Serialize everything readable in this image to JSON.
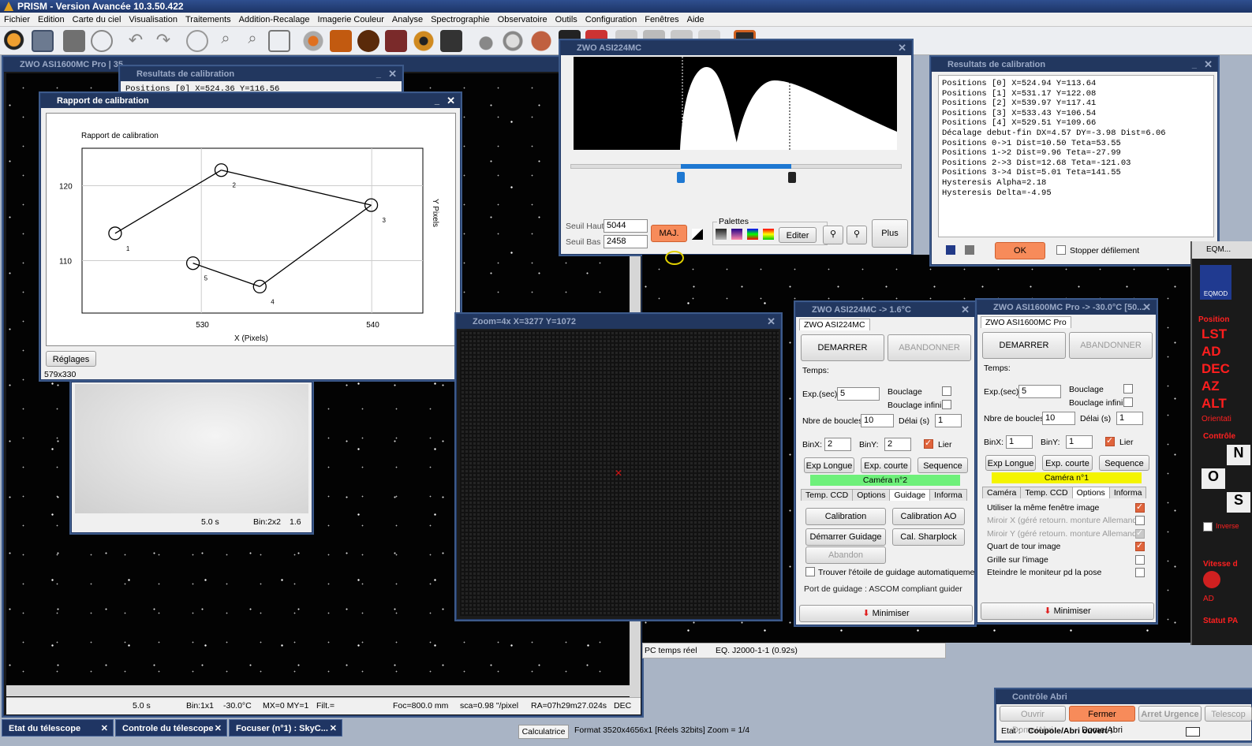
{
  "app": {
    "title": "PRISM - Version Avancée  10.3.50.422"
  },
  "menu": [
    "Fichier",
    "Edition",
    "Carte du ciel",
    "Visualisation",
    "Traitements",
    "Addition-Recalage",
    "Imagerie Couleur",
    "Analyse",
    "Spectrographie",
    "Observatoire",
    "Outils",
    "Configuration",
    "Fenêtres",
    "Aide"
  ],
  "main_image": {
    "title": "ZWO ASI1600MC Pro | 35",
    "status": [
      "5.0 s",
      "Bin:1x1",
      "-30.0°C",
      "MX=0 MY=1",
      "Filt.=",
      "Foc=800.0 mm",
      "sca=0.98 \"/pixel",
      "RA=07h29m27.024s",
      "DEC"
    ]
  },
  "calib_results_bg": {
    "title": "Resultats de calibration",
    "line": "Positions [0] X=524.36 Y=116.56"
  },
  "thumb": {
    "status": [
      "5.0 s",
      "Bin:2x2",
      "1.6"
    ]
  },
  "calib_report": {
    "title": "Rapport de calibration",
    "settings_button": "Réglages",
    "size_label": "579x330"
  },
  "chart_data": {
    "type": "scatter",
    "title": "Rapport de calibration",
    "xlabel": "X (Pixels)",
    "ylabel": "Y Pixels",
    "xticks": [
      "530",
      "540"
    ],
    "yticks": [
      "110",
      "120"
    ],
    "xlim": [
      523,
      543
    ],
    "ylim": [
      103,
      125
    ],
    "points": [
      {
        "label": "1",
        "x": 524.94,
        "y": 113.64
      },
      {
        "label": "2",
        "x": 531.17,
        "y": 122.08
      },
      {
        "label": "3",
        "x": 539.97,
        "y": 117.41
      },
      {
        "label": "4",
        "x": 533.43,
        "y": 106.54
      },
      {
        "label": "5",
        "x": 529.51,
        "y": 109.66
      }
    ]
  },
  "histogram": {
    "title": "ZWO ASI224MC",
    "seuil_haut_label": "Seuil Haut",
    "seuil_haut": "5044",
    "seuil_bas_label": "Seuil Bas",
    "seuil_bas": "2458",
    "maj": "MAJ.",
    "palettes": "Palettes",
    "editer": "Editer",
    "plus": "Plus"
  },
  "zoom": {
    "title": "Zoom=4x  X=3277 Y=1072"
  },
  "calib_results": {
    "title": "Resultats de calibration",
    "lines": [
      "Positions [0] X=524.94 Y=113.64",
      "Positions [1] X=531.17 Y=122.08",
      "Positions [2] X=539.97 Y=117.41",
      "Positions [3] X=533.43 Y=106.54",
      "Positions [4] X=529.51 Y=109.66",
      "Décalage debut-fin DX=4.57 DY=-3.98 Dist=6.06",
      "Positions 0->1 Dist=10.50 Teta=53.55",
      "Positions 1->2 Dist=9.96 Teta=-27.99",
      "Positions 2->3 Dist=12.68 Teta=-121.03",
      "Positions 3->4 Dist=5.01 Teta=141.55",
      "Hysteresis Alpha=2.18",
      "Hysteresis Delta=-4.95"
    ],
    "ok": "OK",
    "stop_scroll": "Stopper défilement"
  },
  "eqmod": {
    "title": "EQM...",
    "logo": "EQMOD",
    "position": "Position",
    "labels": [
      "LST",
      "AD",
      "DEC",
      "AZ",
      "ALT"
    ],
    "orientation": "Orientati",
    "controle": "Contrôle",
    "vitesse": "Vitesse d",
    "statut": "Statut PA",
    "ad_small": "AD",
    "inverse": "Inverse"
  },
  "cam1": {
    "title": "ZWO ASI224MC  -> 1.6°C",
    "tab": "ZWO ASI224MC",
    "start": "DEMARRER",
    "abort": "ABANDONNER",
    "temps": "Temps:",
    "exp_label": "Exp.(sec)",
    "exp": "5",
    "bouclage": "Bouclage",
    "bouclage_infini": "Bouclage infini",
    "nb_label": "Nbre de boucles",
    "nb": "10",
    "delai_label": "Délai (s)",
    "delai": "1",
    "binx_label": "BinX:",
    "binx": "2",
    "biny_label": "BinY:",
    "biny": "2",
    "lier": "Lier",
    "exp_longue": "Exp Longue",
    "exp_courte": "Exp. courte",
    "sequence": "Sequence",
    "camera_n": "Caméra n°2",
    "tabs": [
      "Temp. CCD",
      "Options",
      "Guidage",
      "Informa"
    ],
    "calibration": "Calibration",
    "calibration_ao": "Calibration AO",
    "demarrer_guidage": "Démarrer Guidage",
    "cal_sharplock": "Cal. Sharplock",
    "abandon": "Abandon",
    "trouver": "Trouver l'étoile de guidage automatiquement",
    "port": "Port de guidage : ASCOM compliant guider",
    "minimiser": "Minimiser"
  },
  "cam2": {
    "title": "ZWO ASI1600MC Pro  -> -30.0°C  [50...",
    "tab": "ZWO ASI1600MC Pro",
    "start": "DEMARRER",
    "abort": "ABANDONNER",
    "temps": "Temps:",
    "exp_label": "Exp.(sec)",
    "exp": "5",
    "bouclage": "Bouclage",
    "bouclage_infini": "Bouclage infini",
    "nb_label": "Nbre de boucles",
    "nb": "10",
    "delai_label": "Délai (s)",
    "delai": "1",
    "binx_label": "BinX:",
    "binx": "1",
    "biny_label": "BinY:",
    "biny": "1",
    "lier": "Lier",
    "exp_longue": "Exp Longue",
    "exp_courte": "Exp. courte",
    "sequence": "Sequence",
    "camera_n": "Caméra n°1",
    "tabs": [
      "Caméra",
      "Temp. CCD",
      "Options",
      "Informa"
    ],
    "options": [
      {
        "label": "Utiliser la même fenêtre image",
        "checked": true,
        "disabled": false
      },
      {
        "label": "Miroir X (géré retourn. monture Allemande)",
        "checked": false,
        "disabled": true
      },
      {
        "label": "Miroir Y (géré retourn. monture Allemande)",
        "checked": true,
        "disabled": true
      },
      {
        "label": "Quart de tour image",
        "checked": true,
        "disabled": false
      },
      {
        "label": "Grille sur l'image",
        "checked": false,
        "disabled": false
      },
      {
        "label": "Eteindre le moniteur pd la pose",
        "checked": false,
        "disabled": false
      }
    ],
    "minimiser": "Minimiser"
  },
  "skymap_status": {
    "a": "PC temps réel",
    "b": "EQ. J2000-1-1 (0.92s)"
  },
  "dome": {
    "title": "Contrôle Abri",
    "open": "Ouvrir Dome/Abri",
    "close": "Fermer Dome/Abri",
    "stop": "Arret Urgence",
    "telesc": "Telescop",
    "etat_label": "Etat :",
    "etat": "Coupole/Abri ouvert !"
  },
  "taskbar": {
    "items": [
      "Etat du télescope",
      "Controle du télescope",
      "Focuser (n°1) : SkyC..."
    ],
    "calculatrice": "Calculatrice",
    "format": "Format 3520x4656x1 [Réels 32bits]  Zoom = 1/4"
  },
  "colors": {
    "accent_orange": "#f78b5a",
    "title_blue": "#22375f",
    "green_band": "#6ef07a",
    "yellow_band": "#f4f400",
    "histo_blue": "#1e78d2"
  }
}
